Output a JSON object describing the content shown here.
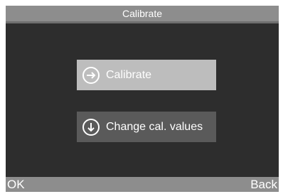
{
  "header": {
    "title": "Calibrate"
  },
  "menu": {
    "items": [
      {
        "label": "Calibrate",
        "icon": "arrow-right-circle-icon",
        "selected": true
      },
      {
        "label": "Change cal. values",
        "icon": "arrow-down-circle-icon",
        "selected": false
      }
    ]
  },
  "softkeys": {
    "left": "OK",
    "right": "Back"
  },
  "colors": {
    "screen_background": "#2d2d2d",
    "bar": "#8d8d8d",
    "selected_item": "#bdbdbd",
    "item": "#5a5a5a",
    "text": "#ffffff"
  }
}
